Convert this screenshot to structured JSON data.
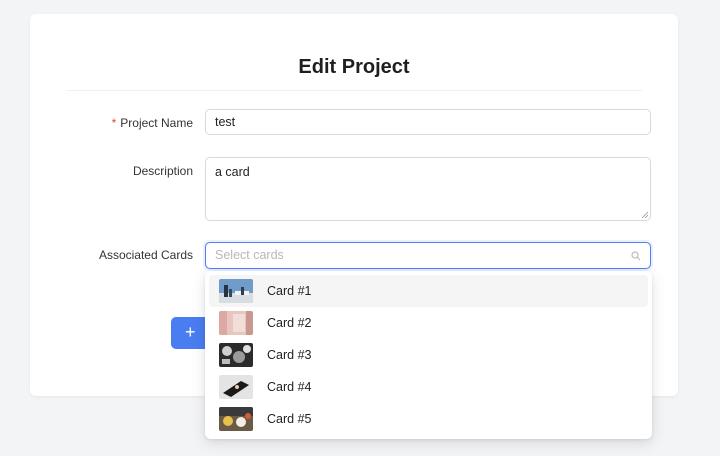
{
  "form": {
    "title": "Edit Project",
    "required_mark": "*",
    "fields": {
      "project_name": {
        "label": "Project Name",
        "value": "test"
      },
      "description": {
        "label": "Description",
        "value": "a card"
      },
      "associated_cards": {
        "label": "Associated Cards",
        "placeholder": "Select cards"
      }
    },
    "add_button_label": "+"
  },
  "dropdown": {
    "options": [
      {
        "label": "Card #1",
        "thumbnail": "city-skyline-thumbnail",
        "highlighted": true
      },
      {
        "label": "Card #2",
        "thumbnail": "pink-fabric-thumbnail",
        "highlighted": false
      },
      {
        "label": "Card #3",
        "thumbnail": "texture-collage-thumbnail",
        "highlighted": false
      },
      {
        "label": "Card #4",
        "thumbnail": "dark-object-thumbnail",
        "highlighted": false
      },
      {
        "label": "Card #5",
        "thumbnail": "colorful-still-life-thumbnail",
        "highlighted": false
      }
    ]
  },
  "colors": {
    "primary": "#4a7df0",
    "required": "#e0453b",
    "focus_border": "#4f7ff5"
  }
}
